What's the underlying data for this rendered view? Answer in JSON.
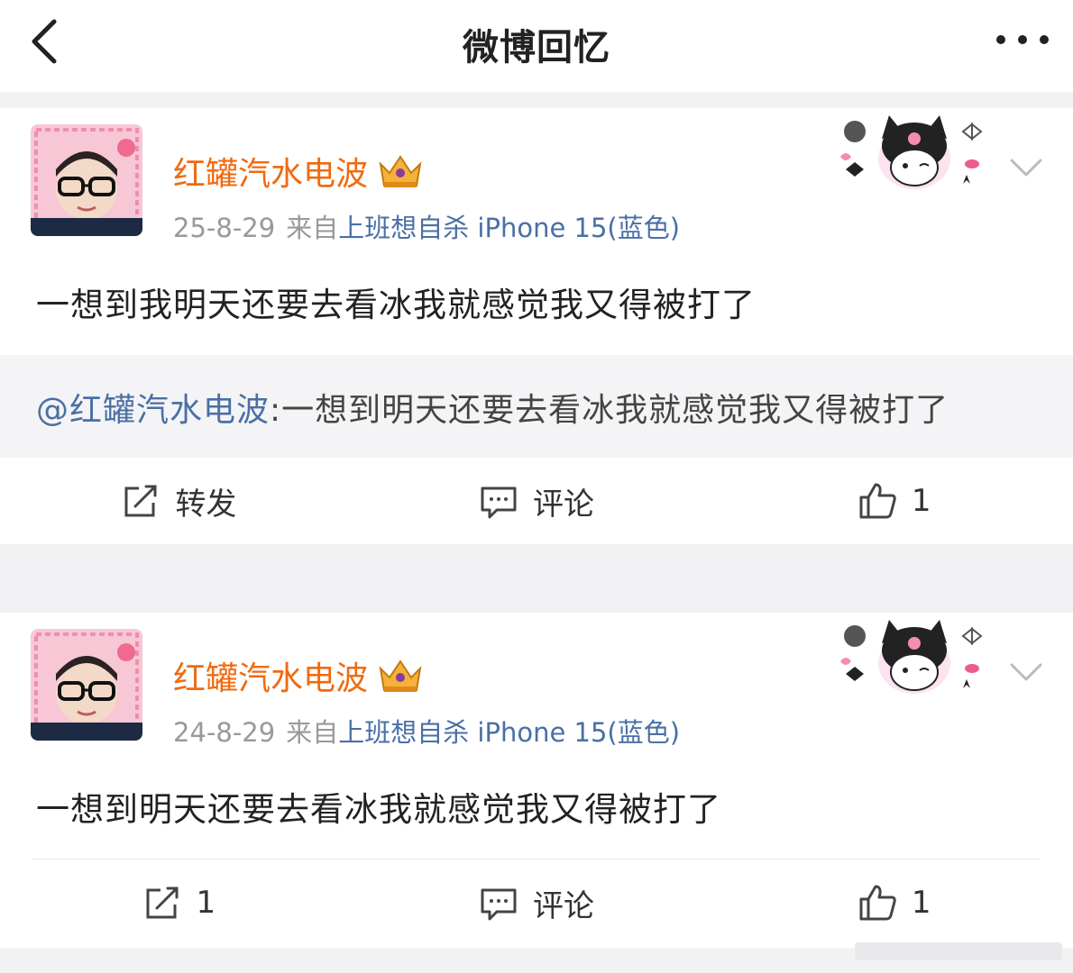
{
  "header": {
    "title": "微博回忆",
    "back_icon": "chevron-left-icon",
    "more_icon": "ellipsis-icon"
  },
  "posts": [
    {
      "username": "红罐汽水电波",
      "date": "25-8-29",
      "source_prefix": "来自",
      "source": "上班想自杀 iPhone 15(蓝色)",
      "text": "一想到我明天还要去看冰我就感觉我又得被打了",
      "quote": {
        "mention": "@红罐汽水电波",
        "text": ":一想到明天还要去看冰我就感觉我又得被打了"
      },
      "actions": {
        "repost": "转发",
        "comment": "评论",
        "like": "1"
      }
    },
    {
      "username": "红罐汽水电波",
      "date": "24-8-29",
      "source_prefix": "来自",
      "source": "上班想自杀 iPhone 15(蓝色)",
      "text": "一想到明天还要去看冰我就感觉我又得被打了",
      "actions": {
        "repost": "1",
        "comment": "评论",
        "like": "1"
      }
    }
  ],
  "colors": {
    "username": "#f06a0f",
    "link": "#4a6fa5",
    "meta": "#999999",
    "background": "#f2f2f4"
  }
}
